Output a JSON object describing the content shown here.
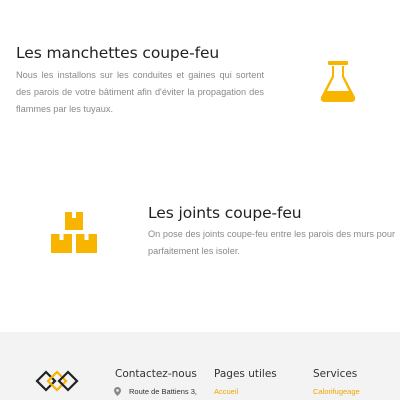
{
  "features": [
    {
      "title": "Les manchettes coupe-feu",
      "text": "Nous les installons sur les conduites et gaines qui sortent des parois de votre bâtiment afin d'éviter la propagation des flammes par les tuyaux.",
      "icon": "flask-icon"
    },
    {
      "title": "Les joints coupe-feu",
      "text": "On pose des joints coupe-feu entre les parois des murs pour parfaitement les isoler.",
      "icon": "boxes-icon"
    }
  ],
  "colors": {
    "accent": "#f7b500",
    "footer_bg": "#f3f3f3",
    "link": "#f0a500"
  },
  "footer": {
    "logo": "diamonds-logo",
    "contact": {
      "title": "Contactez-nous",
      "address_icon": "map-marker-icon",
      "address": "Route de Battiens 3,"
    },
    "pages": {
      "title": "Pages utiles",
      "first_link": "Accueil"
    },
    "services": {
      "title": "Services",
      "first_link": "Calorifugeage"
    }
  }
}
